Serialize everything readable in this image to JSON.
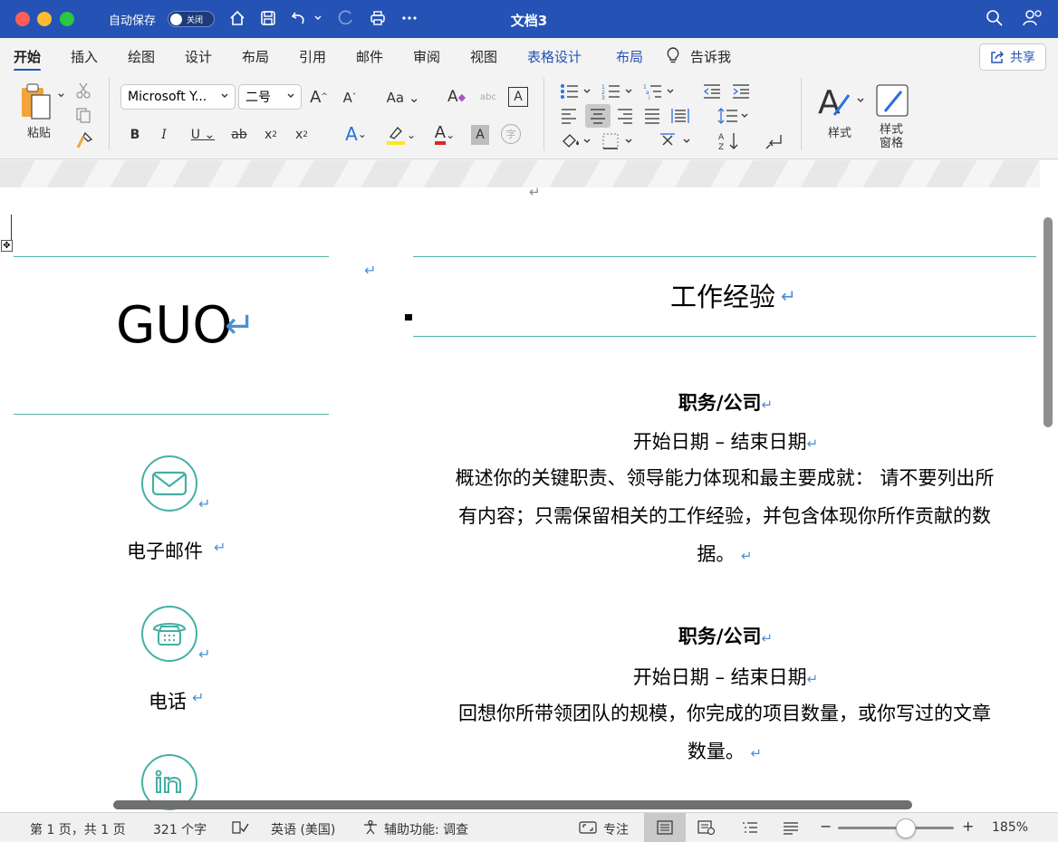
{
  "titlebar": {
    "autosave_label": "自动保存",
    "autosave_state": "关闭",
    "document_title": "文档3"
  },
  "tabs": [
    {
      "label": "开始"
    },
    {
      "label": "插入"
    },
    {
      "label": "绘图"
    },
    {
      "label": "设计"
    },
    {
      "label": "布局"
    },
    {
      "label": "引用"
    },
    {
      "label": "邮件"
    },
    {
      "label": "审阅"
    },
    {
      "label": "视图"
    },
    {
      "label": "表格设计"
    },
    {
      "label": "布局"
    },
    {
      "label": "告诉我"
    }
  ],
  "share_label": "共享",
  "ribbon": {
    "paste_label": "粘贴",
    "font_name": "Microsoft Y...",
    "font_size": "二号",
    "styles_label": "样式",
    "styles_pane_line1": "样式",
    "styles_pane_line2": "窗格"
  },
  "document": {
    "name": "GUO",
    "contacts": [
      {
        "label": "电子邮件"
      },
      {
        "label": "电话"
      }
    ],
    "section_title": "工作经验",
    "jobs": [
      {
        "title": "职务/公司",
        "dates": "开始日期 – 结束日期",
        "desc_lines": [
          "概述你的关键职责、领导能力体现和最主要成就： 请不要列出所",
          "有内容；只需保留相关的工作经验，并包含体现你所作贡献的数",
          "据。"
        ]
      },
      {
        "title": "职务/公司",
        "dates": "开始日期 – 结束日期",
        "desc_lines": [
          "回想你所带领团队的规模，你完成的项目数量，或你写过的文章",
          "数量。"
        ]
      }
    ]
  },
  "statusbar": {
    "page": "第 1 页，共 1 页",
    "words": "321 个字",
    "language": "英语 (美国)",
    "accessibility": "辅助功能: 调查",
    "focus": "专注",
    "zoom": "185%"
  }
}
